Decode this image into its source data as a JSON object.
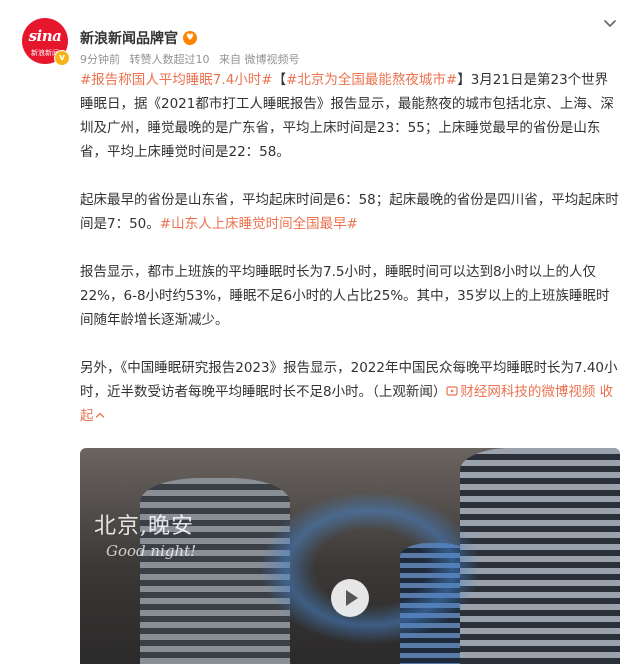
{
  "post": {
    "author": "新浪新闻品牌官",
    "avatar_text": "sina",
    "avatar_subtext": "新浪新闻",
    "verified_badge": "v",
    "fan_badge": "♥",
    "time": "9分钟前",
    "reposts": "转赞人数超过10",
    "source": "来自 微博视频号"
  },
  "content": {
    "p1": {
      "topic1": "#报告称国人平均睡眠7.4小时#",
      "bracket_open": "【",
      "topic2": "#北京为全国最能熬夜城市#",
      "bracket_close": "】",
      "text": "3月21日是第23个世界睡眠日，据《2021都市打工人睡眠报告》报告显示，最能熬夜的城市包括北京、上海、深圳及广州，睡觉最晚的是广东省，平均上床时间是23：55；上床睡觉最早的省份是山东省，平均上床睡觉时间是22：58。"
    },
    "p2": {
      "text": "起床最早的省份是山东省，平均起床时间是6：58；起床最晚的省份是四川省，平均起床时间是7：50。",
      "topic": "#山东人上床睡觉时间全国最早#"
    },
    "p3": {
      "text": "报告显示，都市上班族的平均睡眠时长为7.5小时，睡眠时间可以达到8小时以上的人仅22%，6-8小时约53%，睡眠不足6小时的人占比25%。其中，35岁以上的上班族睡眠时间随年龄增长逐渐减少。"
    },
    "p4": {
      "text": "另外，《中国睡眠研究报告2023》报告显示，2022年中国民众每晚平均睡眠时长为7.40小时，近半数受访者每晚平均睡眠时长不足8小时。（上观新闻）",
      "link": "财经网科技的微博视频",
      "collapse": "收起"
    }
  },
  "video": {
    "title": "北京,晚安",
    "subtitle": "Good night!"
  },
  "colors": {
    "accent": "#eb7350",
    "brand": "#e6162d",
    "text": "#333333",
    "meta": "#939393"
  },
  "icons": {
    "more": "chevron-down-icon",
    "link": "video-link-icon",
    "collapse": "chevron-up-icon",
    "play": "play-icon"
  }
}
